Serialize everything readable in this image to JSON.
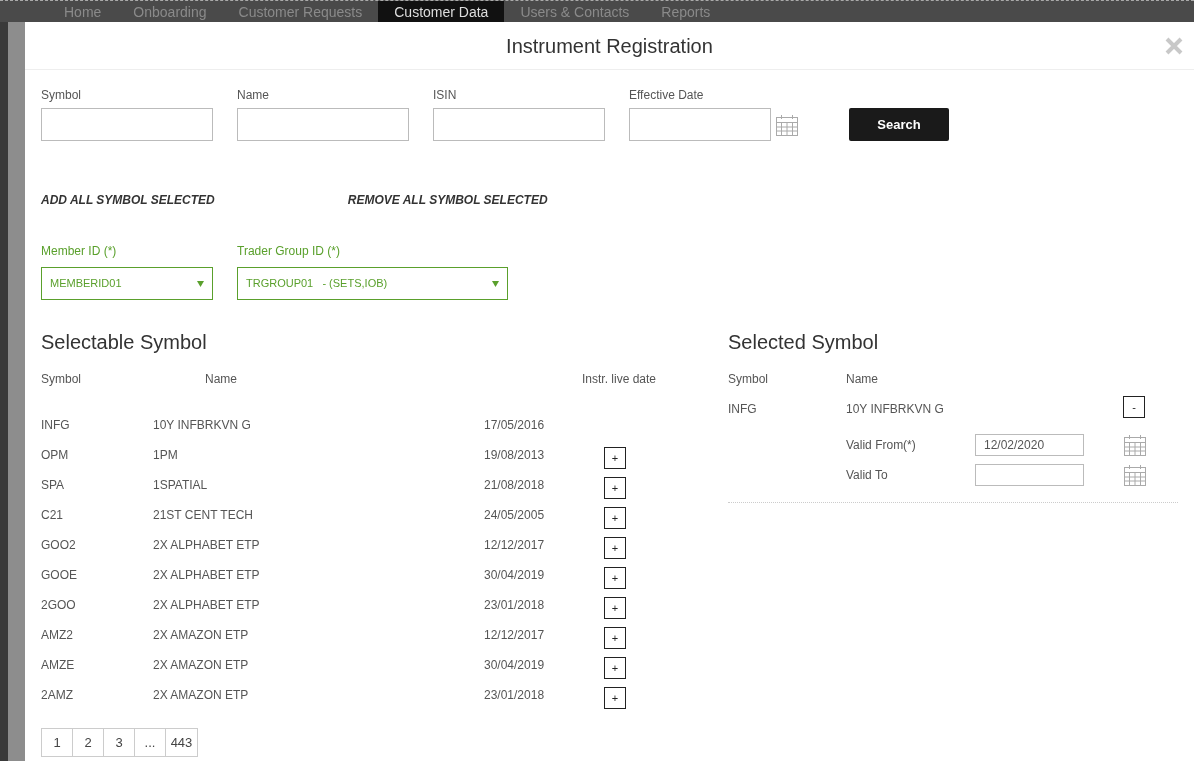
{
  "nav_tabs": [
    {
      "label": "Home",
      "selected": false
    },
    {
      "label": "Onboarding",
      "selected": false
    },
    {
      "label": "Customer Requests",
      "selected": false
    },
    {
      "label": "Customer Data",
      "selected": true
    },
    {
      "label": "Users & Contacts",
      "selected": false
    },
    {
      "label": "Reports",
      "selected": false
    }
  ],
  "dialog": {
    "title": "Instrument Registration"
  },
  "search_fields": [
    {
      "label": "Symbol",
      "kind": "text"
    },
    {
      "label": "Name",
      "kind": "text"
    },
    {
      "label": "ISIN",
      "kind": "text"
    },
    {
      "label": "Effective Date",
      "kind": "date"
    }
  ],
  "search_button": "Search",
  "bulk_actions": [
    "ADD ALL SYMBOL SELECTED",
    "REMOVE ALL SYMBOL SELECTED"
  ],
  "dropdowns": [
    {
      "label": "Member ID (*)",
      "value": "MEMBERID01"
    },
    {
      "label": "Trader Group ID (*)",
      "value": "TRGROUP01   - (SETS,IOB)"
    }
  ],
  "selectable": {
    "title": "Selectable Symbol",
    "columns": [
      "Symbol",
      "Name",
      "Instr. live date"
    ],
    "rows": [
      {
        "symbol": "INFG",
        "name": "10Y INFBRKVN G",
        "date": "17/05/2016"
      },
      {
        "symbol": "OPM",
        "name": "1PM",
        "date": "19/08/2013",
        "add_label": "+"
      },
      {
        "symbol": "SPA",
        "name": "1SPATIAL",
        "date": "21/08/2018",
        "add_label": "+"
      },
      {
        "symbol": "C21",
        "name": "21ST CENT TECH",
        "date": "24/05/2005",
        "add_label": "+"
      },
      {
        "symbol": "GOO2",
        "name": "2X ALPHABET ETP",
        "date": "12/12/2017",
        "add_label": "+"
      },
      {
        "symbol": "GOOE",
        "name": "2X ALPHABET ETP",
        "date": "30/04/2019",
        "add_label": "+"
      },
      {
        "symbol": "2GOO",
        "name": "2X ALPHABET ETP",
        "date": "23/01/2018",
        "add_label": "+"
      },
      {
        "symbol": "AMZ2",
        "name": "2X AMAZON ETP",
        "date": "12/12/2017",
        "add_label": "+"
      },
      {
        "symbol": "AMZE",
        "name": "2X AMAZON ETP",
        "date": "30/04/2019",
        "add_label": "+"
      },
      {
        "symbol": "2AMZ",
        "name": "2X AMAZON ETP",
        "date": "23/01/2018",
        "add_label": "+"
      }
    ]
  },
  "pagination": [
    "1",
    "2",
    "3",
    "...",
    "443"
  ],
  "selected_panel": {
    "title": "Selected Symbol",
    "columns": [
      "Symbol",
      "Name"
    ],
    "rows": [
      {
        "symbol": "INFG",
        "name": "10Y INFBRKVN G",
        "remove_label": "-",
        "valid_from_label": "Valid From(*)",
        "valid_from": "12/02/2020",
        "valid_to_label": "Valid To"
      }
    ]
  }
}
